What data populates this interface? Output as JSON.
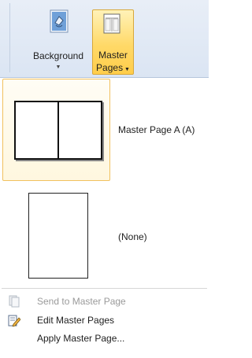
{
  "ribbon": {
    "background_button": {
      "label": "Background",
      "icon": "paint-bucket-icon"
    },
    "master_pages_button": {
      "label_line1": "Master",
      "label_line2": "Pages",
      "icon": "master-page-icon",
      "state": "pressed"
    }
  },
  "gallery": {
    "items": [
      {
        "label": "Master Page A (A)",
        "selected": true
      },
      {
        "label": "(None)",
        "selected": false
      }
    ]
  },
  "menu": {
    "items": [
      {
        "label": "Send to Master Page",
        "enabled": false,
        "icon": "send-to-master-page-icon"
      },
      {
        "label": "Edit Master Pages",
        "enabled": true,
        "icon": "edit-master-pages-icon"
      },
      {
        "label": "Apply Master Page...",
        "enabled": true,
        "icon": null
      }
    ]
  },
  "colors": {
    "selection_border": "#f1c15f",
    "pressed_button": "#ffd968",
    "ribbon_bg": "#dbe5f3",
    "disabled_text": "#9a9a9a"
  }
}
